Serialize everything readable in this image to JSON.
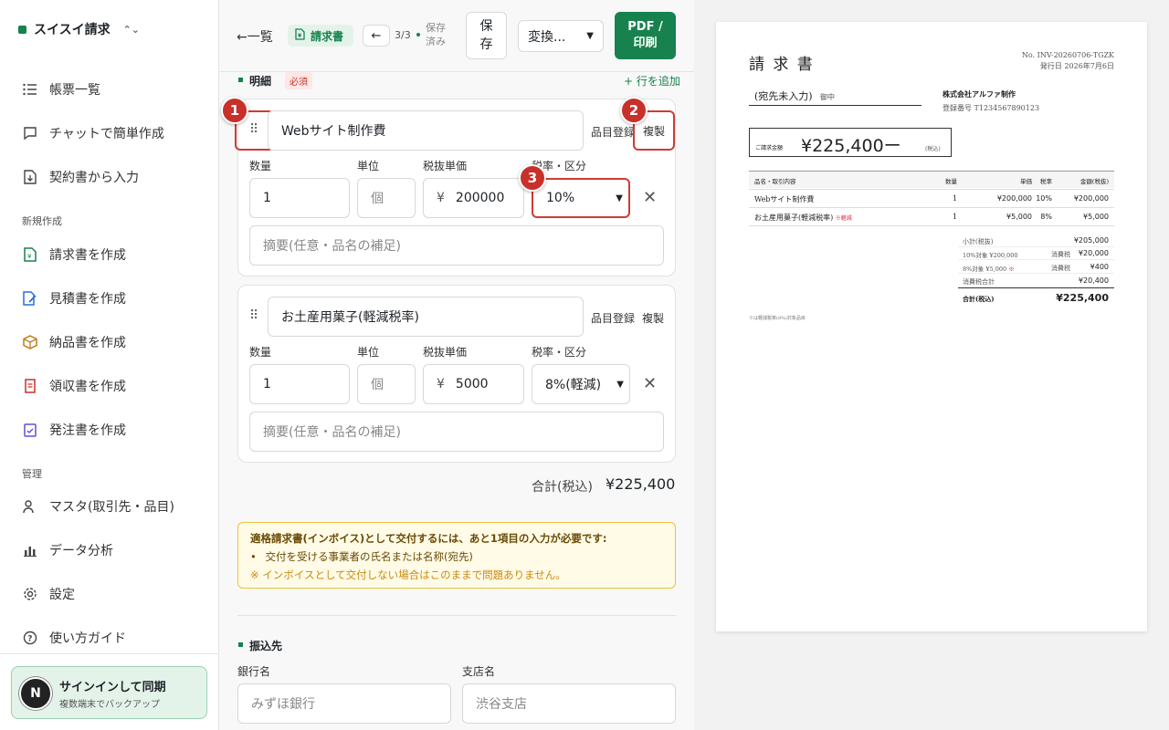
{
  "sidebar": {
    "app_name": "スイスイ請求",
    "items": [
      {
        "label": "帳票一覧",
        "icon": "list-icon"
      },
      {
        "label": "チャットで簡単作成",
        "icon": "chat-icon"
      },
      {
        "label": "契約書から入力",
        "icon": "document-import-icon"
      }
    ],
    "section_new": "新規作成",
    "new_items": [
      {
        "label": "請求書を作成",
        "icon": "invoice-icon",
        "color": "#17824d"
      },
      {
        "label": "見積書を作成",
        "icon": "estimate-icon",
        "color": "#2a6fd6"
      },
      {
        "label": "納品書を作成",
        "icon": "box-icon",
        "color": "#c07a1c"
      },
      {
        "label": "領収書を作成",
        "icon": "receipt-icon",
        "color": "#c8312a"
      },
      {
        "label": "発注書を作成",
        "icon": "order-icon",
        "color": "#6b4bd1"
      }
    ],
    "section_admin": "管理",
    "admin_items": [
      {
        "label": "マスタ(取引先・品目)",
        "icon": "users-icon"
      },
      {
        "label": "データ分析",
        "icon": "bar-chart-icon"
      },
      {
        "label": "設定",
        "icon": "gear-icon"
      },
      {
        "label": "使い方ガイド",
        "icon": "help-icon"
      }
    ],
    "signin": {
      "avatar": "N",
      "title": "サインインして同期",
      "subtitle": "複数端末でバックアップ"
    }
  },
  "toolbar": {
    "back": "←一覧",
    "doc_type": "請求書",
    "prev": "←",
    "page": "3/3",
    "saved": "保存済み",
    "save": "保存",
    "convert": "変換...",
    "pdf": "PDF / 印刷"
  },
  "details": {
    "title": "明細",
    "required": "必須",
    "add_row": "+ 行を追加"
  },
  "labels": {
    "qty": "数量",
    "unit": "単位",
    "price": "税抜単価",
    "tax": "税率・区分",
    "register": "品目登録",
    "duplicate": "複製",
    "memo_placeholder": "摘要(任意・品名の補足)",
    "yen": "¥"
  },
  "rows": [
    {
      "name": "Webサイト制作費",
      "qty": "1",
      "unit": "個",
      "price": "200000",
      "tax": "10%"
    },
    {
      "name": "お土産用菓子(軽減税率)",
      "qty": "1",
      "unit": "個",
      "price": "5000",
      "tax": "8%(軽減)"
    }
  ],
  "total": {
    "label": "合計(税込)",
    "value": "¥225,400"
  },
  "notice": {
    "title": "適格請求書(インボイス)として交付するには、あと1項目の入力が必要です:",
    "item": "交付を受ける事業者の氏名または名称(宛先)",
    "note": "※ インボイスとして交付しない場合はこのままで問題ありません。"
  },
  "bank": {
    "title": "振込先",
    "bank_label": "銀行名",
    "bank_value": "みずほ銀行",
    "branch_label": "支店名",
    "branch_value": "渋谷支店"
  },
  "badges": [
    "1",
    "2",
    "3"
  ],
  "preview": {
    "title": "請 求 書",
    "number": "No. INV-20260706-TGZK",
    "date": "発行日 2026年7月6日",
    "recipient": "(宛先未入力)",
    "onchu": "御中",
    "company": "株式会社アルファ制作",
    "reg": "登録番号 T1234567890123",
    "amount_label": "ご請求金額",
    "amount": "¥225,400ー",
    "amount_tax": "(税込)",
    "headers": [
      "品名・取引内容",
      "数量",
      "単価",
      "税率",
      "金額(税抜)"
    ],
    "rows": [
      {
        "name": "Webサイト制作費",
        "mark": "",
        "qty": "1",
        "price": "¥200,000",
        "rate": "10%",
        "amount": "¥200,000"
      },
      {
        "name": "お土産用菓子(軽減税率)",
        "mark": "※軽減",
        "qty": "1",
        "price": "¥5,000",
        "rate": "8%",
        "amount": "¥5,000"
      }
    ],
    "subtotal_label": "小計(税抜)",
    "subtotal": "¥205,000",
    "t10_label": "10%対象 ¥200,000",
    "t10_tax_label": "消費税",
    "t10_tax": "¥20,000",
    "t8_label": "8%対象 ¥5,000",
    "t8_mark": "※",
    "t8_tax_label": "消費税",
    "t8_tax": "¥400",
    "tax_total_label": "消費税合計",
    "tax_total": "¥20,400",
    "grand_label": "合計(税込)",
    "grand": "¥225,400",
    "footnote": "※は軽減税率(8%)対象品目"
  }
}
